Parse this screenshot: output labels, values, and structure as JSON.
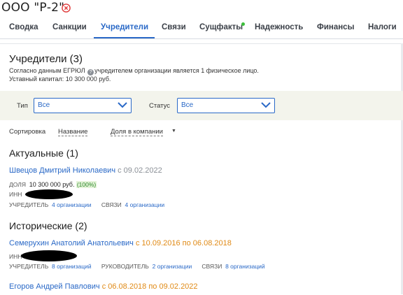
{
  "header": {
    "company_name": "ООО \"Р-2\""
  },
  "tabs": [
    {
      "label": "Сводка"
    },
    {
      "label": "Санкции"
    },
    {
      "label": "Учредители",
      "active": true
    },
    {
      "label": "Связи"
    },
    {
      "label": "Сущфакты",
      "has_indicator": true
    },
    {
      "label": "Надежность"
    },
    {
      "label": "Финансы"
    },
    {
      "label": "Налоги"
    }
  ],
  "founders": {
    "title": "Учредители (3)",
    "egrul_prefix": "Согласно данным ЕГРЮЛ",
    "egrul_suffix": "учредителем организации является 1 физическое лицо.",
    "capital": "Уставный капитал: 10 300 000 руб."
  },
  "filters": {
    "type_label": "Тип",
    "type_value": "Все",
    "status_label": "Статус",
    "status_value": "Все"
  },
  "sort": {
    "label": "Сортировка",
    "by_name": "Название",
    "by_share": "Доля в компании"
  },
  "current": {
    "heading": "Актуальные (1)",
    "people": [
      {
        "name": "Швецов Дмитрий Николаевич",
        "date": "с 09.02.2022",
        "share_label": "ДОЛЯ",
        "share_value": "10 300 000 руб.",
        "share_percent": "(100%)",
        "inn_label": "ИНН",
        "founder_label": "УЧРЕДИТЕЛЬ",
        "founder_link": "4 организации",
        "links_label": "СВЯЗИ",
        "links_link": "4 организации"
      }
    ]
  },
  "historical": {
    "heading": "Исторические (2)",
    "people": [
      {
        "name": "Семерухин Анатолий Анатольевич",
        "date": "с 10.09.2016 по 06.08.2018",
        "inn_label": "ИНН",
        "founder_label": "УЧРЕДИТЕЛЬ",
        "founder_link": "8 организаций",
        "head_label": "РУКОВОДИТЕЛЬ",
        "head_link": "2 организации",
        "links_label": "СВЯЗИ",
        "links_link": "8 организаций"
      },
      {
        "name": "Егоров Андрей Павлович",
        "date": "с 06.08.2018 по 09.02.2022"
      }
    ]
  },
  "colors": {
    "accent": "#2a69c7",
    "orange": "#e08a16",
    "filter_bg": "#f3f4ec",
    "close_red": "#e03a3a",
    "indicator_green": "#3cbf3c"
  }
}
